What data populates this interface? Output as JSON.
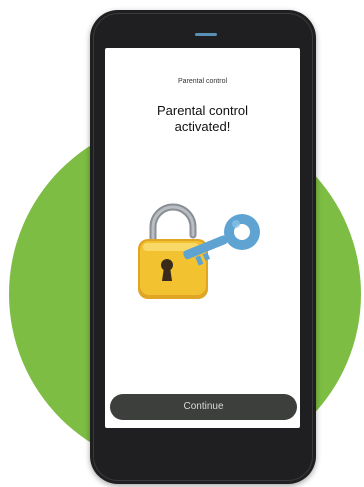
{
  "colors": {
    "background_circle": "#7dbd43",
    "phone_body": "#1f1f21",
    "button_bg": "#3d3f3c",
    "lock_body": "#f2c230",
    "key_color": "#5fa3d3"
  },
  "screen": {
    "header": "Parental control",
    "headline": "Parental control\nactivated!",
    "illustration": "padlock-with-key-icon",
    "continue_label": "Continue"
  }
}
